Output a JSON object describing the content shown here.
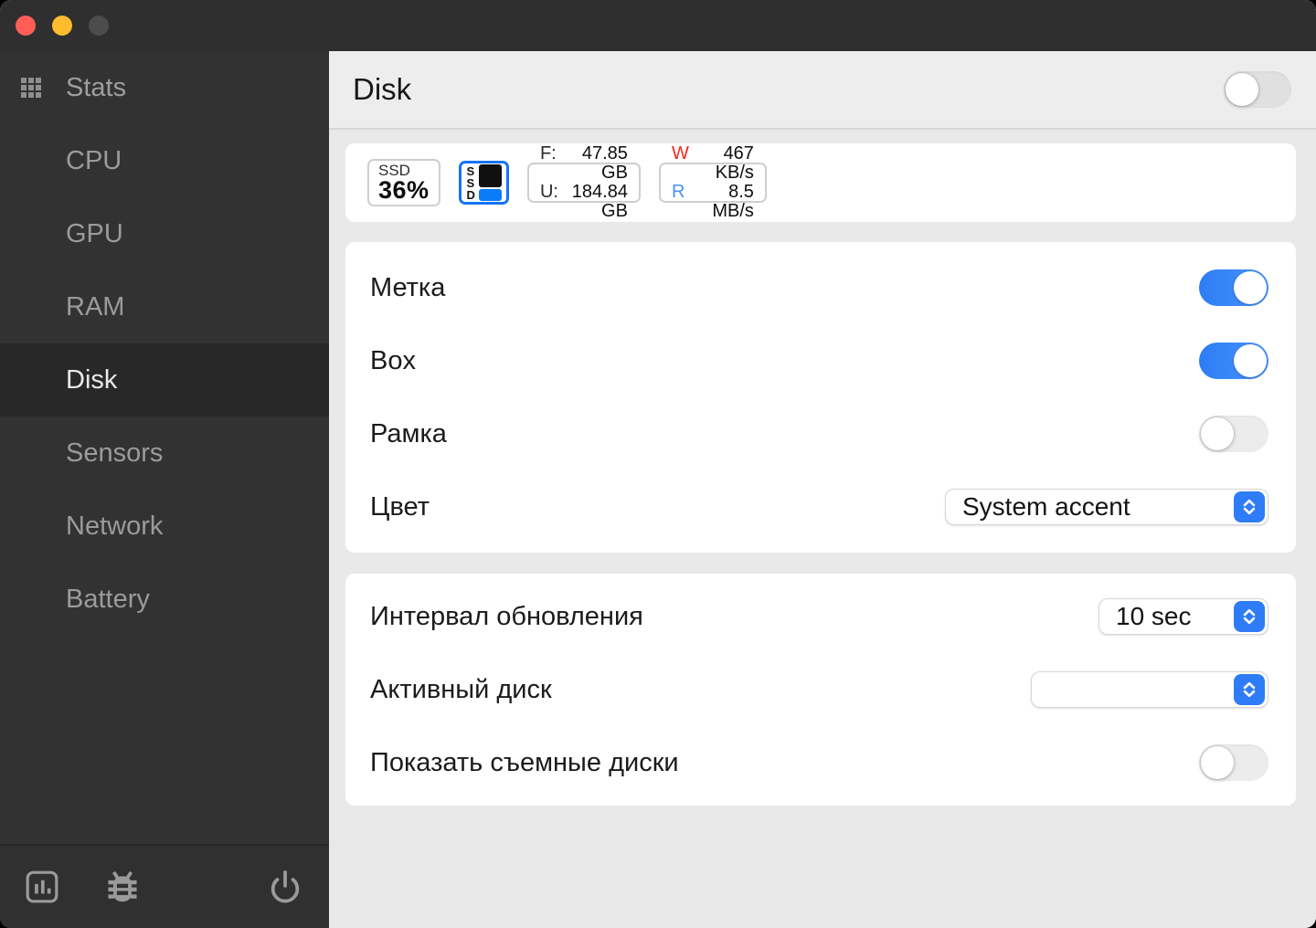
{
  "window": {
    "traffic_lights": {
      "close": "#ff5f57",
      "minimize": "#febc2e",
      "zoom_disabled": "#4c4c4c"
    }
  },
  "sidebar": {
    "app_item": {
      "label": "Stats",
      "icon": "grid-icon"
    },
    "items": [
      {
        "label": "CPU",
        "selected": false
      },
      {
        "label": "GPU",
        "selected": false
      },
      {
        "label": "RAM",
        "selected": false
      },
      {
        "label": "Disk",
        "selected": true
      },
      {
        "label": "Sensors",
        "selected": false
      },
      {
        "label": "Network",
        "selected": false
      },
      {
        "label": "Battery",
        "selected": false
      }
    ],
    "footer_icons": [
      "activity-chart-icon",
      "bug-icon",
      "power-icon"
    ]
  },
  "header": {
    "title": "Disk",
    "module_toggle_on": false
  },
  "widgets": {
    "mini": {
      "label": "SSD",
      "value": "36%",
      "selected": false
    },
    "bar": {
      "letters": [
        "S",
        "S",
        "D"
      ],
      "selected": true
    },
    "capacity": {
      "rows": [
        {
          "label": "F:",
          "value": "47.85 GB"
        },
        {
          "label": "U:",
          "value": "184.84 GB"
        }
      ]
    },
    "speed": {
      "rows": [
        {
          "label": "W",
          "value": "467 KB/s",
          "color": "#fa251b"
        },
        {
          "label": "R",
          "value": "8.5 MB/s",
          "color": "#4a90f9"
        }
      ]
    }
  },
  "settings": {
    "widget_card": [
      {
        "label": "Метка",
        "control": "toggle",
        "value": true
      },
      {
        "label": "Box",
        "control": "toggle",
        "value": true
      },
      {
        "label": "Рамка",
        "control": "toggle",
        "value": false
      },
      {
        "label": "Цвет",
        "control": "select",
        "value": "System accent"
      }
    ],
    "module_card": [
      {
        "label": "Интервал обновления",
        "control": "select",
        "value": "10 sec"
      },
      {
        "label": "Активный диск",
        "control": "select",
        "value": ""
      },
      {
        "label": "Показать съемные диски",
        "control": "toggle",
        "value": false
      }
    ]
  },
  "colors": {
    "accent_blue": "#2e7cf7",
    "toggle_on_blue": "#3684f7",
    "selected_widget_border": "#1673f6",
    "write_red": "#fa251b",
    "read_blue": "#4a90f9",
    "bar_used_black": "#101010",
    "bar_free_blue": "#0c7bf8"
  }
}
